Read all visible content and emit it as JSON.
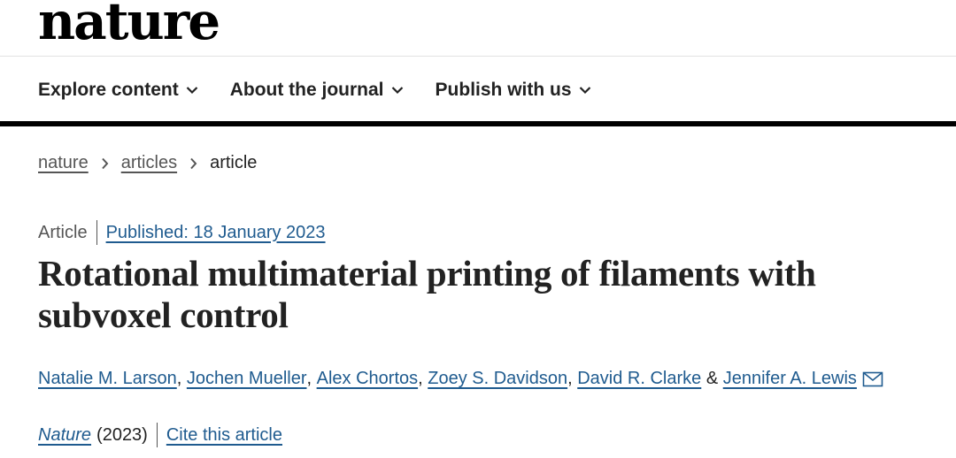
{
  "header": {
    "logo_text": "nature",
    "nav": [
      {
        "label": "Explore content"
      },
      {
        "label": "About the journal"
      },
      {
        "label": "Publish with us"
      }
    ]
  },
  "breadcrumb": {
    "items": [
      "nature",
      "articles"
    ],
    "current": "article"
  },
  "article": {
    "type": "Article",
    "published": "Published: 18 January 2023",
    "title": "Rotational multimaterial printing of filaments with subvoxel control",
    "authors": [
      "Natalie M. Larson",
      "Jochen Mueller",
      "Alex Chortos",
      "Zoey S. Davidson",
      "David R. Clarke",
      "Jennifer A. Lewis"
    ],
    "separators": {
      "comma": ", ",
      "and": " & "
    },
    "journal": "Nature",
    "year": "(2023)",
    "cite_label": "Cite this article"
  },
  "colors": {
    "link": "#1f5b8f",
    "text": "#222222",
    "muted": "#555555"
  },
  "icons": {
    "nav_chevron": "chevron-down-icon",
    "breadcrumb_sep": "chevron-right-icon",
    "correspondence": "mail-icon"
  }
}
